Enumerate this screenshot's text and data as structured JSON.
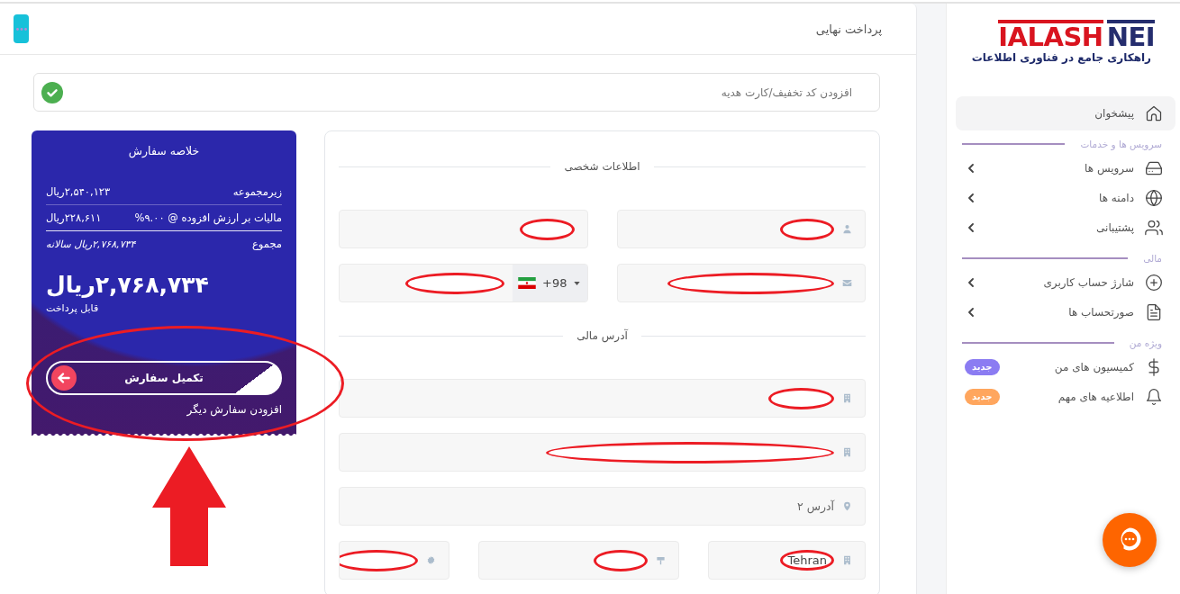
{
  "header": {
    "title": "پرداخت نهایی"
  },
  "coupon": {
    "placeholder": "افزودن کد تخفیف/کارت هدیه"
  },
  "form": {
    "sections": [
      {
        "title": "اطلاعات شخصی",
        "rows": [
          [
            {
              "kind": "text",
              "circled": true
            },
            {
              "kind": "text",
              "circled": true
            }
          ],
          [
            {
              "kind": "text",
              "circled": true
            },
            {
              "kind": "phone",
              "country_code": "+98",
              "circled": true
            }
          ]
        ]
      },
      {
        "title": "آدرس مالی",
        "rows": [
          [
            {
              "kind": "text",
              "circled": true
            }
          ],
          [
            {
              "kind": "text",
              "circled": true
            }
          ],
          [
            {
              "kind": "text",
              "placeholder": "آدرس ۲",
              "circled": false
            }
          ],
          [
            {
              "kind": "text",
              "value": "Tehran",
              "circled": true
            },
            {
              "kind": "text",
              "circled": true
            },
            {
              "kind": "text",
              "circled": true
            }
          ]
        ]
      }
    ]
  },
  "order_summary": {
    "title": "خلاصه سفارش",
    "lines": [
      {
        "kind": "subtotal",
        "label": "زیرمجموعه",
        "amount": "۲,۵۴۰,۱۲۳ریال"
      },
      {
        "kind": "tax",
        "label": "مالیات بر ارزش افزوده @ ۹.۰۰%",
        "amount": "۲۲۸,۶۱۱ریال"
      },
      {
        "kind": "total",
        "label": "مجموع",
        "amount": "۲,۷۶۸,۷۳۴ریال سالانه"
      }
    ],
    "total_due": "۲,۷۶۸,۷۳۴ریال",
    "total_caption": "قابل پرداخت",
    "checkout_button": "تکمیل سفارش",
    "add_order_link": "افزودن سفارش دیگر"
  },
  "sidebar": {
    "logo": {
      "wordmark_start": "IALASH",
      "wordmark_end": "NEI",
      "slogan": "راهکاری جامع در فناوری اطلاعات"
    },
    "top_items": [
      {
        "label": "پیشخوان",
        "selected": true,
        "expandable": false
      }
    ],
    "sections": [
      {
        "title": "سرویس ها و خدمات",
        "items": [
          {
            "label": "سرویس ها",
            "selected": false,
            "expandable": true
          },
          {
            "label": "دامنه ها",
            "selected": false,
            "expandable": true
          },
          {
            "label": "پشتیبانی",
            "selected": false,
            "expandable": true
          }
        ]
      },
      {
        "title": "مالی",
        "items": [
          {
            "label": "شارژ حساب کاربری",
            "selected": false,
            "expandable": true
          },
          {
            "label": "صورتحساب ها",
            "selected": false,
            "expandable": true
          }
        ]
      },
      {
        "title": "ویژه من",
        "items": [
          {
            "label": "کمیسیون های من",
            "selected": false,
            "expandable": false,
            "badge": {
              "text": "جدید",
              "color": "#8b7cf2"
            }
          },
          {
            "label": "اطلاعیه های مهم",
            "selected": false,
            "expandable": false,
            "badge": {
              "text": "جدید",
              "color": "#ffa65e"
            }
          }
        ]
      }
    ]
  }
}
